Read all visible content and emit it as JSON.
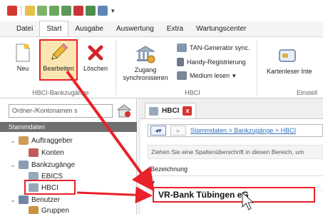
{
  "ribbon_tabs": [
    "Datei",
    "Start",
    "Ausgabe",
    "Auswertung",
    "Extra",
    "Wartungscenter"
  ],
  "active_tab": "Start",
  "ribbon": {
    "new_label": "Neu",
    "edit_label": "Bearbeiten",
    "delete_label": "Löschen",
    "group1_label": "HBCI-Bankzugänge",
    "sync_label_1": "Zugang",
    "sync_label_2": "synchronisieren",
    "tan_sync_label": "TAN-Generator sync.",
    "handy_label": "Handy-Registrierung",
    "medium_label": "Medium lesen",
    "medium_dropdown_glyph": "▾",
    "group2_label": "HBCI",
    "card_reader_label": "Kartenleser Inte",
    "group3_label": "Einstell"
  },
  "nav": {
    "search_placeholder": "Ordner-/Kontonamen s",
    "section_label": "Stammdaten",
    "tree": [
      {
        "label": "Auftraggeber",
        "chevron": "⌄"
      },
      {
        "label": "Konten",
        "chevron": ""
      },
      {
        "label": "Bankzugänge",
        "chevron": "⌄"
      },
      {
        "label": "EBICS",
        "chevron": ""
      },
      {
        "label": "HBCI",
        "chevron": ""
      },
      {
        "label": "Benutzer",
        "chevron": "⌄"
      },
      {
        "label": "Gruppen",
        "chevron": ""
      }
    ]
  },
  "content": {
    "doc_tab_label": "HBCI",
    "doc_tab_close": "x",
    "back_glyph": "◂▾",
    "forward_glyph": "▸",
    "breadcrumb": "Stammdaten > Bankzugänge > HBCI",
    "group_hint": "Ziehen Sie eine Spaltenüberschrift in diesen Bereich, um",
    "column_header": "Bezeichnung",
    "filter_glyph": "▼",
    "row_value": "VR-Bank Tübingen eG"
  },
  "colors": {
    "highlight_red": "#e8212a",
    "link_blue": "#2f6fc0",
    "selected_button_bg": "#fbe6b2"
  }
}
